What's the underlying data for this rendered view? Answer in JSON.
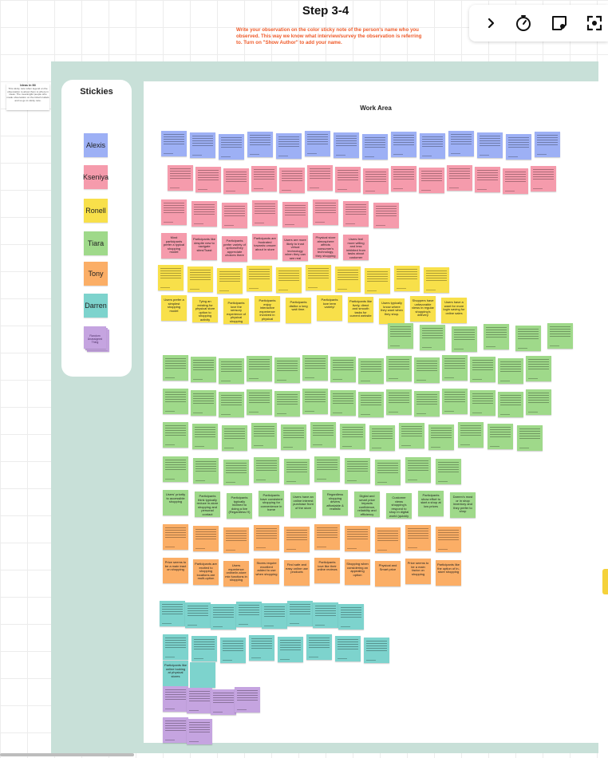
{
  "header": {
    "title": "Step 3-4",
    "instructions": "Write your observation on the color sticky note of the person's name who you observed. This way we know what interview/survey the observation is referring to. Turn on \"Show Author\" to add your name."
  },
  "toolbar": {
    "buttons": [
      {
        "name": "expand-chevron",
        "icon": "chevron-right-icon"
      },
      {
        "name": "timer",
        "icon": "timer-icon"
      },
      {
        "name": "sticky-note",
        "icon": "sticky-note-icon"
      },
      {
        "name": "focus",
        "icon": "focus-frame-icon"
      }
    ]
  },
  "side_note": {
    "title": "Ideas in Mi",
    "body": "This sticky note when legend on the observation to about them to where in ideas. The meaningful people who made observation on the ticket's labels and so go to sticky note."
  },
  "stickies_panel": {
    "title": "Stickies",
    "people": [
      {
        "name": "Alexis",
        "color": "#9db0f5"
      },
      {
        "name": "Kseniya",
        "color": "#f59bac"
      },
      {
        "name": "Ronell",
        "color": "#f8e04a"
      },
      {
        "name": "Tiara",
        "color": "#9fd98a"
      },
      {
        "name": "Tony",
        "color": "#fbae66"
      },
      {
        "name": "Darren",
        "color": "#7dd3cd"
      }
    ],
    "pile_label": "Random Unassigned Thing"
  },
  "work_area": {
    "title": "Work Area",
    "legible_notes": [
      "Most participants prefer a typical shopping model",
      "Participants like despite new to navigate sites/Toast",
      "Participants prefer variety of options/they appreciate choices there",
      "Participants are frustrated towards unsure about in store",
      "Users are more likely to trust virtual technology when they can see real product/try them",
      "Physical store atmosphere affects consumer's technology, they shopping experience",
      "Users feel more willing and less inhibited from tasks about customer reviews and questions features",
      "Users prefer a simplest shopping model",
      "Tying an existing for physical store option to shopping activity",
      "Participants love the sensory experience of physical shopping",
      "Participants enjoy interactive experience involved in physical shopping",
      "Participants dislike a long wait time.",
      "Participants love term variety!",
      "Participants like lively, direct and smooth tasks for current website",
      "Users typically know where they want when they shop.",
      "Shoppers have unfavorable views in regular shopping's delivery",
      "Users have a want for more login saving for online sales",
      "Users' priority to accessible shopping",
      "Participants think typically reduce in-store shopping and personal contact",
      "Participants typically inclined to doing a live (Regardless H)",
      "Participants have consistent shopping for convenience in home",
      "Users have an online interest purchase front of the store",
      "Regardless shopping drivers affordable & realistic",
      "Digital and smart price impacts confidence, reliability and efficiency stores",
      "Customer views shopping's respond to shop in digital world (quickly fit)",
      "Participants show effort to start a shop at low prices",
      "Darren's most or in shop inventory and they prefer to shop",
      "Price seems to be a main tract on shopping",
      "Participants are excited to shopping locations are multi-option",
      "Users experience online/in-store mix functions in shopping",
      "Stores require excellent added to use when shopping",
      "Find safe and easy online use products",
      "Participants love like their online reviews",
      "Shopping when considering an appealing option",
      "Physical and Smart price",
      "Price seems to be a main factor on shopping",
      "Participants like the option of in-store shopping",
      "Participants like online looking at physical stores"
    ]
  }
}
